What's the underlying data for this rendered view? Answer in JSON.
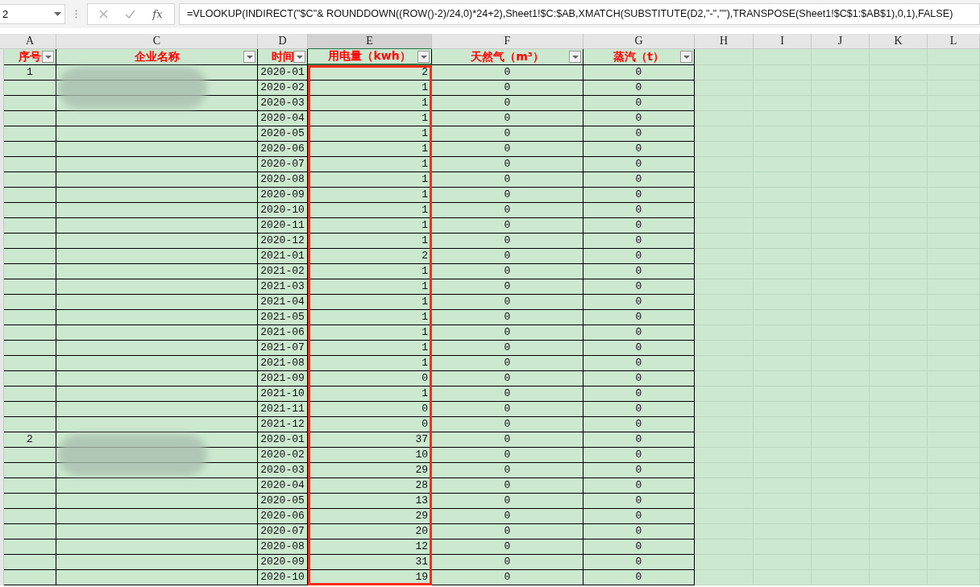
{
  "formula_bar": {
    "name_box": "2",
    "fx_label": "fx",
    "formula": "=VLOOKUP(INDIRECT(\"$C\"& ROUNDDOWN((ROW()-2)/24,0)*24+2),Sheet1!$C:$AB,XMATCH(SUBSTITUTE(D2,\"-\",\"\"),TRANSPOSE(Sheet1!$C$1:$AB$1),0,1),FALSE)"
  },
  "column_letters": [
    {
      "label": "A",
      "selected": false
    },
    {
      "label": "C",
      "selected": false
    },
    {
      "label": "D",
      "selected": false
    },
    {
      "label": "E",
      "selected": true
    },
    {
      "label": "F",
      "selected": false
    },
    {
      "label": "G",
      "selected": false
    },
    {
      "label": "H",
      "selected": false
    },
    {
      "label": "I",
      "selected": false
    },
    {
      "label": "J",
      "selected": false
    },
    {
      "label": "K",
      "selected": false
    },
    {
      "label": "L",
      "selected": false
    }
  ],
  "headers": [
    {
      "label": "序号",
      "filter": true,
      "highlighted": false
    },
    {
      "label": "企业名称",
      "filter": true,
      "highlighted": false
    },
    {
      "label": "时间",
      "filter": true,
      "highlighted": false
    },
    {
      "label": "用电量（kwh）",
      "filter": true,
      "highlighted": true
    },
    {
      "label": "天然气（m³）",
      "filter": true,
      "highlighted": false
    },
    {
      "label": "蒸汽（t）",
      "filter": true,
      "highlighted": false
    }
  ],
  "groups": [
    {
      "seq": "1",
      "name_blurred": true,
      "rows": [
        {
          "time": "2020-01",
          "electricity": "2",
          "gas": "0",
          "steam": "0"
        },
        {
          "time": "2020-02",
          "electricity": "1",
          "gas": "0",
          "steam": "0"
        },
        {
          "time": "2020-03",
          "electricity": "1",
          "gas": "0",
          "steam": "0"
        },
        {
          "time": "2020-04",
          "electricity": "1",
          "gas": "0",
          "steam": "0"
        },
        {
          "time": "2020-05",
          "electricity": "1",
          "gas": "0",
          "steam": "0"
        },
        {
          "time": "2020-06",
          "electricity": "1",
          "gas": "0",
          "steam": "0"
        },
        {
          "time": "2020-07",
          "electricity": "1",
          "gas": "0",
          "steam": "0"
        },
        {
          "time": "2020-08",
          "electricity": "1",
          "gas": "0",
          "steam": "0"
        },
        {
          "time": "2020-09",
          "electricity": "1",
          "gas": "0",
          "steam": "0"
        },
        {
          "time": "2020-10",
          "electricity": "1",
          "gas": "0",
          "steam": "0"
        },
        {
          "time": "2020-11",
          "electricity": "1",
          "gas": "0",
          "steam": "0"
        },
        {
          "time": "2020-12",
          "electricity": "1",
          "gas": "0",
          "steam": "0"
        },
        {
          "time": "2021-01",
          "electricity": "2",
          "gas": "0",
          "steam": "0"
        },
        {
          "time": "2021-02",
          "electricity": "1",
          "gas": "0",
          "steam": "0"
        },
        {
          "time": "2021-03",
          "electricity": "1",
          "gas": "0",
          "steam": "0"
        },
        {
          "time": "2021-04",
          "electricity": "1",
          "gas": "0",
          "steam": "0"
        },
        {
          "time": "2021-05",
          "electricity": "1",
          "gas": "0",
          "steam": "0"
        },
        {
          "time": "2021-06",
          "electricity": "1",
          "gas": "0",
          "steam": "0"
        },
        {
          "time": "2021-07",
          "electricity": "1",
          "gas": "0",
          "steam": "0"
        },
        {
          "time": "2021-08",
          "electricity": "1",
          "gas": "0",
          "steam": "0"
        },
        {
          "time": "2021-09",
          "electricity": "0",
          "gas": "0",
          "steam": "0"
        },
        {
          "time": "2021-10",
          "electricity": "1",
          "gas": "0",
          "steam": "0"
        },
        {
          "time": "2021-11",
          "electricity": "0",
          "gas": "0",
          "steam": "0"
        },
        {
          "time": "2021-12",
          "electricity": "0",
          "gas": "0",
          "steam": "0"
        }
      ]
    },
    {
      "seq": "2",
      "name_blurred": true,
      "rows": [
        {
          "time": "2020-01",
          "electricity": "37",
          "gas": "0",
          "steam": "0"
        },
        {
          "time": "2020-02",
          "electricity": "10",
          "gas": "0",
          "steam": "0"
        },
        {
          "time": "2020-03",
          "electricity": "29",
          "gas": "0",
          "steam": "0"
        },
        {
          "time": "2020-04",
          "electricity": "28",
          "gas": "0",
          "steam": "0"
        },
        {
          "time": "2020-05",
          "electricity": "13",
          "gas": "0",
          "steam": "0"
        },
        {
          "time": "2020-06",
          "electricity": "29",
          "gas": "0",
          "steam": "0"
        },
        {
          "time": "2020-07",
          "electricity": "20",
          "gas": "0",
          "steam": "0"
        },
        {
          "time": "2020-08",
          "electricity": "12",
          "gas": "0",
          "steam": "0"
        },
        {
          "time": "2020-09",
          "electricity": "31",
          "gas": "0",
          "steam": "0"
        },
        {
          "time": "2020-10",
          "electricity": "19",
          "gas": "0",
          "steam": "0"
        }
      ]
    }
  ]
}
